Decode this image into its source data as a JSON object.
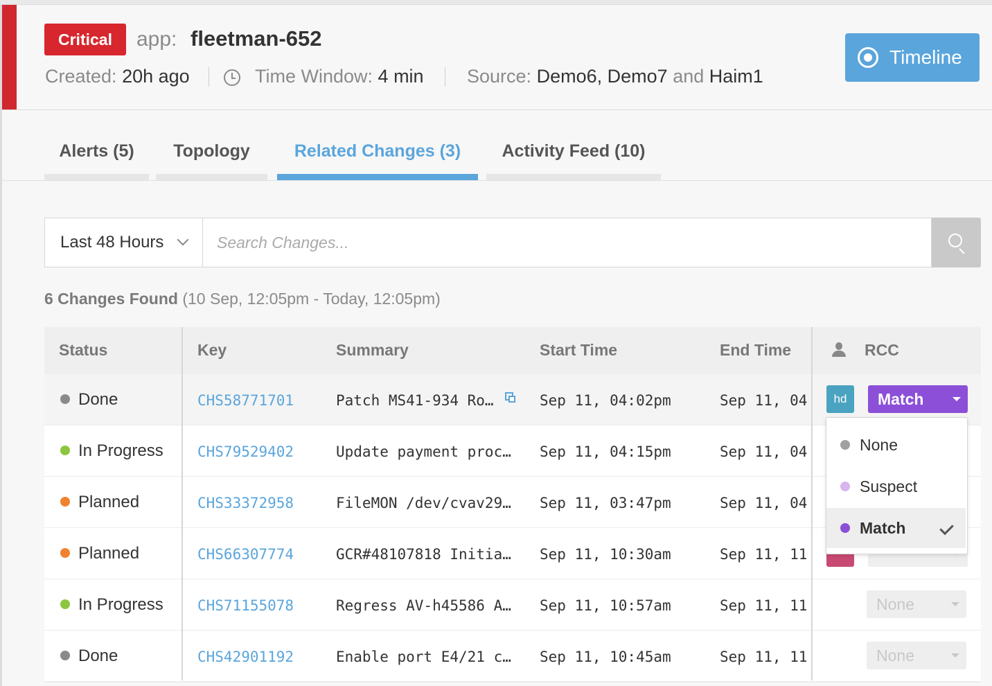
{
  "header": {
    "severity": "Critical",
    "app_prefix": "app:",
    "app_name": "fleetman-652",
    "created_label": "Created:",
    "created_value": "20h ago",
    "window_label": "Time Window:",
    "window_value": "4 min",
    "source_label": "Source:",
    "source_value_1": "Demo6, Demo7",
    "source_and": "and",
    "source_value_2": "Haim1",
    "timeline_label": "Timeline"
  },
  "tabs": [
    {
      "label": "Alerts (5)"
    },
    {
      "label": "Topology"
    },
    {
      "label": "Related Changes (3)"
    },
    {
      "label": "Activity Feed (10)"
    }
  ],
  "filter": {
    "range_value": "Last 48 Hours",
    "search_placeholder": "Search Changes..."
  },
  "results": {
    "count": "6 Changes Found",
    "range": "(10 Sep, 12:05pm - Today, 12:05pm)"
  },
  "table": {
    "headers": {
      "status": "Status",
      "key": "Key",
      "summary": "Summary",
      "start": "Start Time",
      "end": "End Time",
      "rcc": "RCC"
    },
    "rows": [
      {
        "status": "Done",
        "status_color": "#8a8a8a",
        "key": "CHS58771701",
        "summary": "Patch MS41-934 Ro…",
        "start": "Sep 11, 04:02pm",
        "end": "Sep 11, 04",
        "assignee": "hd",
        "assignee_color": "#4aa3c0",
        "rcc": "Match"
      },
      {
        "status": "In Progress",
        "status_color": "#8cc63f",
        "key": "CHS79529402",
        "summary": "Update payment proc…",
        "start": "Sep 11, 04:15pm",
        "end": "Sep 11, 04"
      },
      {
        "status": "Planned",
        "status_color": "#f0822f",
        "key": "CHS33372958",
        "summary": "FileMON /dev/cvav29…",
        "start": "Sep 11, 03:47pm",
        "end": "Sep 11, 04"
      },
      {
        "status": "Planned",
        "status_color": "#f0822f",
        "key": "CHS66307774",
        "summary": "GCR#48107818 Initia…",
        "start": "Sep 11, 10:30am",
        "end": "Sep 11, 11",
        "assignee_color": "#c84a73"
      },
      {
        "status": "In Progress",
        "status_color": "#8cc63f",
        "key": "CHS71155078",
        "summary": "Regress AV-h45586 A…",
        "start": "Sep 11, 10:57am",
        "end": "Sep 11, 11",
        "rcc": "None"
      },
      {
        "status": "Done",
        "status_color": "#8a8a8a",
        "key": "CHS42901192",
        "summary": "Enable port E4/21 c…",
        "start": "Sep 11, 10:45am",
        "end": "Sep 11, 11",
        "rcc": "None"
      }
    ]
  },
  "rcc_dropdown": {
    "options": [
      {
        "label": "None",
        "color": "#a0a0a0"
      },
      {
        "label": "Suspect",
        "color": "#d7b6f0"
      },
      {
        "label": "Match",
        "color": "#8b4fd8",
        "selected": true
      }
    ]
  },
  "colors": {
    "critical": "#d7262d",
    "accent": "#5aa5dc",
    "match": "#8b4fd8"
  },
  "icons": [
    "clock-icon",
    "record-icon",
    "chevron-down-icon",
    "search-icon",
    "copy-icon",
    "user-icon",
    "caret-down-icon",
    "checkmark-icon"
  ]
}
